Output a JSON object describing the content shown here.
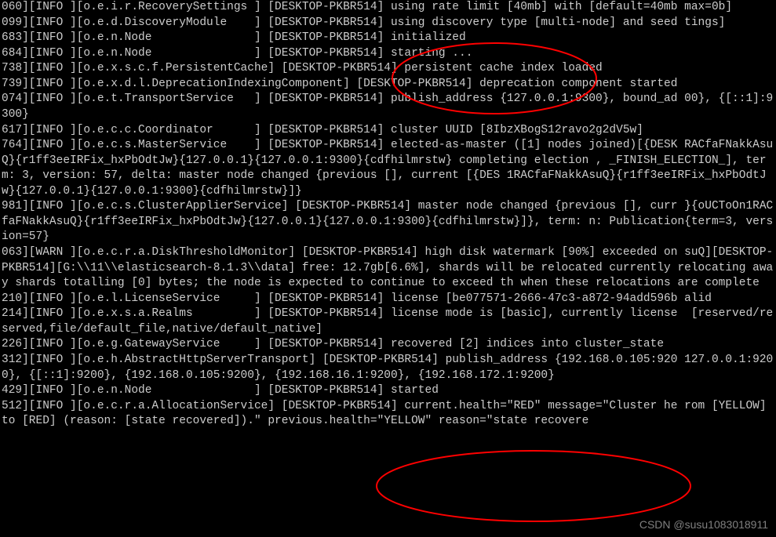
{
  "terminal": {
    "lines": [
      "060][INFO ][o.e.i.r.RecoverySettings ] [DESKTOP-PKBR514] using rate limit [40mb] with [default=40mb max=0b]",
      "099][INFO ][o.e.d.DiscoveryModule    ] [DESKTOP-PKBR514] using discovery type [multi-node] and seed tings]",
      "683][INFO ][o.e.n.Node               ] [DESKTOP-PKBR514] initialized",
      "684][INFO ][o.e.n.Node               ] [DESKTOP-PKBR514] starting ...",
      "738][INFO ][o.e.x.s.c.f.PersistentCache] [DESKTOP-PKBR514] persistent cache index loaded",
      "739][INFO ][o.e.x.d.l.DeprecationIndexingComponent] [DESKTOP-PKBR514] deprecation component started",
      "",
      "074][INFO ][o.e.t.TransportService   ] [DESKTOP-PKBR514] publish_address {127.0.0.1:9300}, bound_ad 00}, {[::1]:9300}",
      "617][INFO ][o.e.c.c.Coordinator      ] [DESKTOP-PKBR514] cluster UUID [8IbzXBogS12ravo2g2dV5w]",
      "764][INFO ][o.e.c.s.MasterService    ] [DESKTOP-PKBR514] elected-as-master ([1] nodes joined)[{DESK RACfaFNakkAsuQ}{r1ff3eeIRFix_hxPbOdtJw}{127.0.0.1}{127.0.0.1:9300}{cdfhilmrstw} completing election , _FINISH_ELECTION_], term: 3, version: 57, delta: master node changed {previous [], current [{DES 1RACfaFNakkAsuQ}{r1ff3eeIRFix_hxPbOdtJw}{127.0.0.1}{127.0.0.1:9300}{cdfhilmrstw}]}",
      "981][INFO ][o.e.c.s.ClusterApplierService] [DESKTOP-PKBR514] master node changed {previous [], curr }{oUCToOn1RACfaFNakkAsuQ}{r1ff3eeIRFix_hxPbOdtJw}{127.0.0.1}{127.0.0.1:9300}{cdfhilmrstw}]}, term: n: Publication{term=3, version=57}",
      "063][WARN ][o.e.c.r.a.DiskThresholdMonitor] [DESKTOP-PKBR514] high disk watermark [90%] exceeded on suQ][DESKTOP-PKBR514][G:\\\\11\\\\elasticsearch-8.1.3\\\\data] free: 12.7gb[6.6%], shards will be relocated currently relocating away shards totalling [0] bytes; the node is expected to continue to exceed th when these relocations are complete",
      "210][INFO ][o.e.l.LicenseService     ] [DESKTOP-PKBR514] license [be077571-2666-47c3-a872-94add596b alid",
      "214][INFO ][o.e.x.s.a.Realms         ] [DESKTOP-PKBR514] license mode is [basic], currently license  [reserved/reserved,file/default_file,native/default_native]",
      "226][INFO ][o.e.g.GatewayService     ] [DESKTOP-PKBR514] recovered [2] indices into cluster_state",
      "312][INFO ][o.e.h.AbstractHttpServerTransport] [DESKTOP-PKBR514] publish_address {192.168.0.105:920 127.0.0.1:9200}, {[::1]:9200}, {192.168.0.105:9200}, {192.168.16.1:9200}, {192.168.172.1:9200}",
      "429][INFO ][o.e.n.Node               ] [DESKTOP-PKBR514] started",
      "512][INFO ][o.e.c.r.a.AllocationService] [DESKTOP-PKBR514] current.health=\"RED\" message=\"Cluster he rom [YELLOW] to [RED] (reason: [state recovered]).\" previous.health=\"YELLOW\" reason=\"state recovere"
    ]
  },
  "watermark": "CSDN @susu1083018911",
  "annotations": {
    "stroke": "#ff0000",
    "strokeWidth": 2
  }
}
